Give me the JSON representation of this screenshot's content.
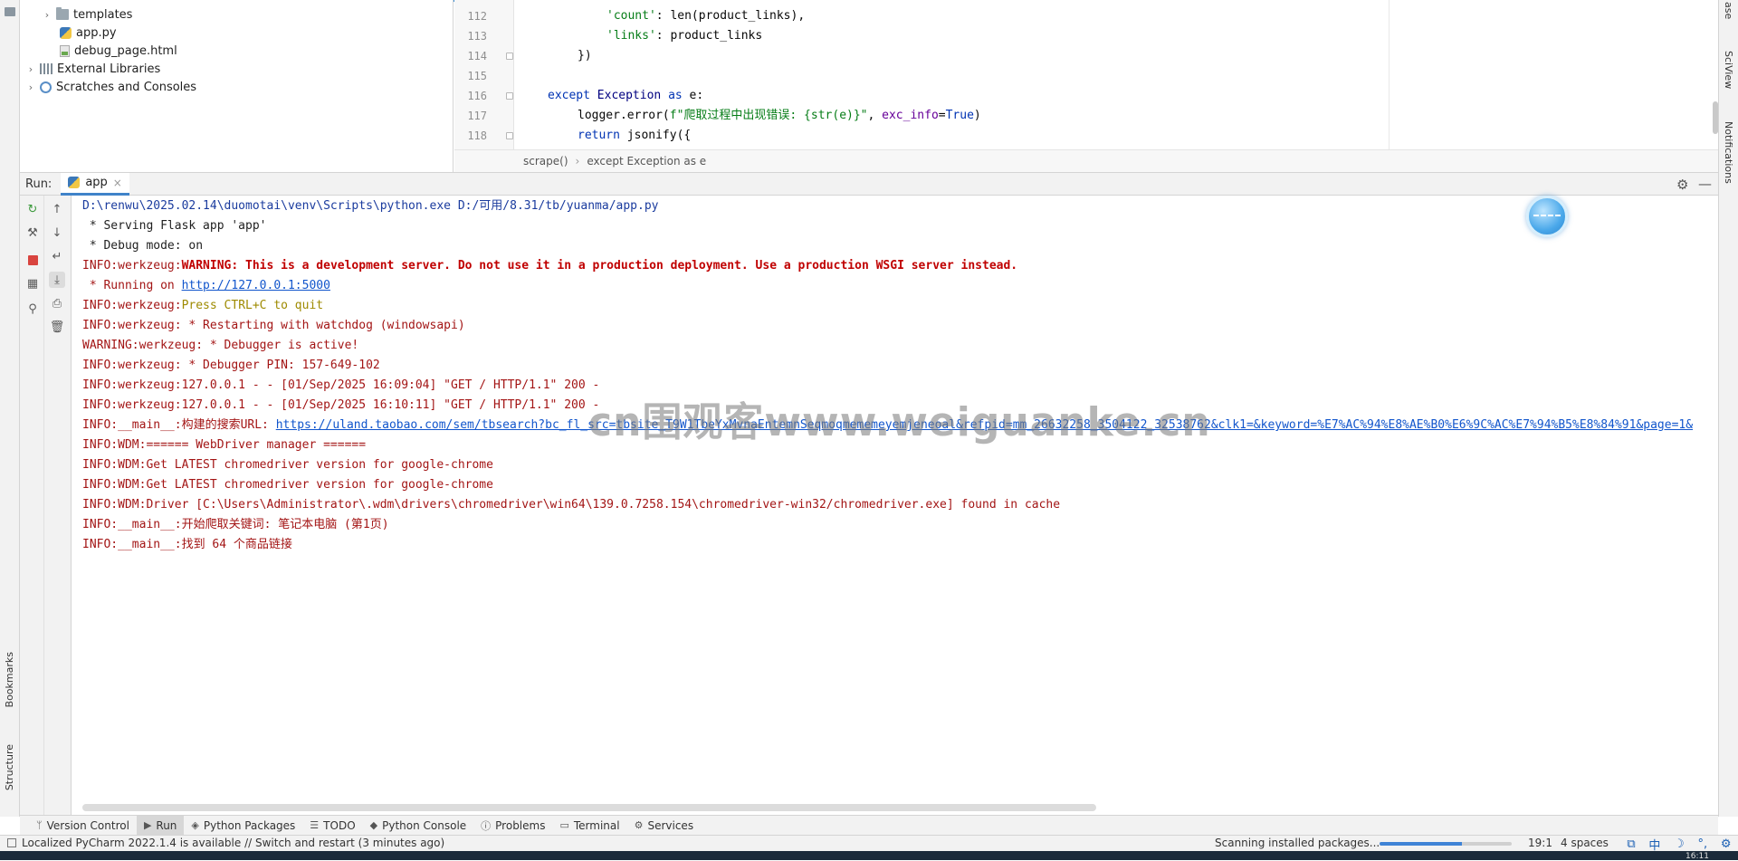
{
  "project_tree": {
    "items": [
      {
        "label": "templates",
        "type": "folder"
      },
      {
        "label": "app.py",
        "type": "python"
      },
      {
        "label": "debug_page.html",
        "type": "html"
      },
      {
        "label": "External Libraries",
        "type": "library"
      },
      {
        "label": "Scratches and Consoles",
        "type": "scratch"
      }
    ]
  },
  "editor": {
    "lines": [
      {
        "num": "112"
      },
      {
        "num": "113"
      },
      {
        "num": "114"
      },
      {
        "num": "115"
      },
      {
        "num": "116"
      },
      {
        "num": "117"
      },
      {
        "num": "118"
      }
    ],
    "code": {
      "l112_key": "'count'",
      "l112_rest": ": len(product_links),",
      "l113_key": "'links'",
      "l113_rest": ": product_links",
      "l114": "})",
      "l116_kw1": "except",
      "l116_mid": " Exception ",
      "l116_kw2": "as",
      "l116_rest": " e:",
      "l117_pre": "logger.error(",
      "l117_str": "f\"爬取过程中出现错误: {str(e)}\"",
      "l117_mid": ", ",
      "l117_kwarg": "exc_info",
      "l117_eq": "=",
      "l117_true": "True",
      "l117_end": ")",
      "l118_kw": "return",
      "l118_rest": " jsonify({"
    },
    "breadcrumb": [
      "scrape()",
      "except Exception as e"
    ]
  },
  "left_strip": {
    "bookmarks": "Bookmarks",
    "structure": "Structure"
  },
  "right_strip": {
    "database": "ase",
    "sciview": "SciView",
    "notifications": "Notifications"
  },
  "run_panel": {
    "label": "Run:",
    "tab": "app",
    "tab_close": "×"
  },
  "console": {
    "lines": {
      "l1": "D:\\renwu\\2025.02.14\\duomotai\\venv\\Scripts\\python.exe D:/可用/8.31/tb/yuanma/app.py",
      "l2": " * Serving Flask app 'app'",
      "l3": " * Debug mode: on",
      "l4_pre": "INFO:werkzeug:",
      "l4_bold": "WARNING: This is a development server. Do not use it in a production deployment. Use a production WSGI server instead.",
      "l5_pre": " * Running on ",
      "l5_link": "http://127.0.0.1:5000",
      "l6_pre": "INFO:werkzeug:",
      "l6_ok": "Press CTRL+C to quit",
      "l7": "INFO:werkzeug: * Restarting with watchdog (windowsapi)",
      "l8": "WARNING:werkzeug: * Debugger is active!",
      "l9": "INFO:werkzeug: * Debugger PIN: 157-649-102",
      "l10": "INFO:werkzeug:127.0.0.1 - - [01/Sep/2025 16:09:04] \"GET / HTTP/1.1\" 200 -",
      "l11": "INFO:werkzeug:127.0.0.1 - - [01/Sep/2025 16:10:11] \"GET / HTTP/1.1\" 200 -",
      "l12_pre": "INFO:__main__:构建的搜索URL: ",
      "l12_link": "https://uland.taobao.com/sem/tbsearch?bc_fl_src=tbsite_T9W1TbeYxMvnaEntemnSeqmoqmememeyemjeneoal&refpid=mm_26632258_3504122_32538762&clk1=&keyword=%E7%AC%94%E8%AE%B0%E6%9C%AC%E7%94%B5%E8%84%91&page=1&",
      "l13": "INFO:WDM:====== WebDriver manager ======",
      "l14": "INFO:WDM:Get LATEST chromedriver version for google-chrome",
      "l15": "INFO:WDM:Get LATEST chromedriver version for google-chrome",
      "l16": "INFO:WDM:Driver [C:\\Users\\Administrator\\.wdm\\drivers\\chromedriver\\win64\\139.0.7258.154\\chromedriver-win32/chromedriver.exe] found in cache",
      "l17": "INFO:__main__:开始爬取关键词: 笔记本电脑 (第1页)",
      "l18": "INFO:__main__:找到 64 个商品链接"
    },
    "watermark": "cn围观客www.weiguanke.cn"
  },
  "tool_tabs": [
    {
      "label": "Version Control",
      "icon": "branch-icon"
    },
    {
      "label": "Run",
      "icon": "play-icon"
    },
    {
      "label": "Python Packages",
      "icon": "layers-icon"
    },
    {
      "label": "TODO",
      "icon": "list-icon"
    },
    {
      "label": "Python Console",
      "icon": "python-icon"
    },
    {
      "label": "Problems",
      "icon": "info-icon"
    },
    {
      "label": "Terminal",
      "icon": "terminal-icon"
    },
    {
      "label": "Services",
      "icon": "services-icon"
    }
  ],
  "status_bar": {
    "message": "Localized PyCharm 2022.1.4 is available // Switch and restart (3 minutes ago)",
    "scanning": "Scanning installed packages...",
    "progress": 0.62,
    "position": "19:1",
    "indent": "4 spaces",
    "ime": [
      "中",
      "☽",
      "°,",
      "⚙"
    ]
  },
  "tray": {
    "clock": "16:11"
  },
  "colors": {
    "accent": "#4083c9",
    "error": "#c00000",
    "log": "#a31515",
    "link": "#1155cc"
  }
}
